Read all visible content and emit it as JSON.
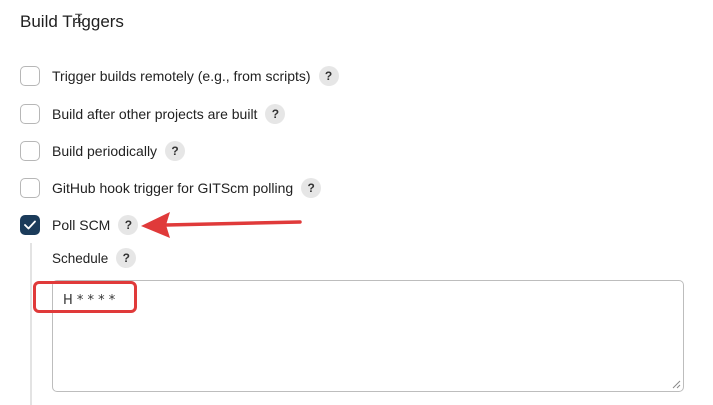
{
  "section": {
    "title": "Build Triggers"
  },
  "options": [
    {
      "label": "Trigger builds remotely (e.g., from scripts)",
      "checked": false
    },
    {
      "label": "Build after other projects are built",
      "checked": false
    },
    {
      "label": "Build periodically",
      "checked": false
    },
    {
      "label": "GitHub hook trigger for GITScm polling",
      "checked": false
    },
    {
      "label": "Poll SCM",
      "checked": true
    }
  ],
  "help_label": "?",
  "schedule": {
    "label": "Schedule",
    "value": "H * * * *"
  },
  "colors": {
    "checked": "#1b3b5a",
    "annotation": "#e03a3a"
  }
}
